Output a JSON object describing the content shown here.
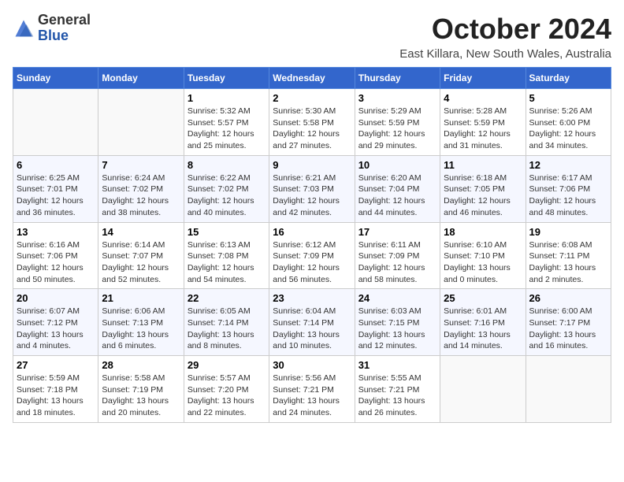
{
  "header": {
    "logo_general": "General",
    "logo_blue": "Blue",
    "month": "October 2024",
    "location": "East Killara, New South Wales, Australia"
  },
  "weekdays": [
    "Sunday",
    "Monday",
    "Tuesday",
    "Wednesday",
    "Thursday",
    "Friday",
    "Saturday"
  ],
  "weeks": [
    [
      {
        "day": "",
        "sunrise": "",
        "sunset": "",
        "daylight": ""
      },
      {
        "day": "",
        "sunrise": "",
        "sunset": "",
        "daylight": ""
      },
      {
        "day": "1",
        "sunrise": "Sunrise: 5:32 AM",
        "sunset": "Sunset: 5:57 PM",
        "daylight": "Daylight: 12 hours and 25 minutes."
      },
      {
        "day": "2",
        "sunrise": "Sunrise: 5:30 AM",
        "sunset": "Sunset: 5:58 PM",
        "daylight": "Daylight: 12 hours and 27 minutes."
      },
      {
        "day": "3",
        "sunrise": "Sunrise: 5:29 AM",
        "sunset": "Sunset: 5:59 PM",
        "daylight": "Daylight: 12 hours and 29 minutes."
      },
      {
        "day": "4",
        "sunrise": "Sunrise: 5:28 AM",
        "sunset": "Sunset: 5:59 PM",
        "daylight": "Daylight: 12 hours and 31 minutes."
      },
      {
        "day": "5",
        "sunrise": "Sunrise: 5:26 AM",
        "sunset": "Sunset: 6:00 PM",
        "daylight": "Daylight: 12 hours and 34 minutes."
      }
    ],
    [
      {
        "day": "6",
        "sunrise": "Sunrise: 6:25 AM",
        "sunset": "Sunset: 7:01 PM",
        "daylight": "Daylight: 12 hours and 36 minutes."
      },
      {
        "day": "7",
        "sunrise": "Sunrise: 6:24 AM",
        "sunset": "Sunset: 7:02 PM",
        "daylight": "Daylight: 12 hours and 38 minutes."
      },
      {
        "day": "8",
        "sunrise": "Sunrise: 6:22 AM",
        "sunset": "Sunset: 7:02 PM",
        "daylight": "Daylight: 12 hours and 40 minutes."
      },
      {
        "day": "9",
        "sunrise": "Sunrise: 6:21 AM",
        "sunset": "Sunset: 7:03 PM",
        "daylight": "Daylight: 12 hours and 42 minutes."
      },
      {
        "day": "10",
        "sunrise": "Sunrise: 6:20 AM",
        "sunset": "Sunset: 7:04 PM",
        "daylight": "Daylight: 12 hours and 44 minutes."
      },
      {
        "day": "11",
        "sunrise": "Sunrise: 6:18 AM",
        "sunset": "Sunset: 7:05 PM",
        "daylight": "Daylight: 12 hours and 46 minutes."
      },
      {
        "day": "12",
        "sunrise": "Sunrise: 6:17 AM",
        "sunset": "Sunset: 7:06 PM",
        "daylight": "Daylight: 12 hours and 48 minutes."
      }
    ],
    [
      {
        "day": "13",
        "sunrise": "Sunrise: 6:16 AM",
        "sunset": "Sunset: 7:06 PM",
        "daylight": "Daylight: 12 hours and 50 minutes."
      },
      {
        "day": "14",
        "sunrise": "Sunrise: 6:14 AM",
        "sunset": "Sunset: 7:07 PM",
        "daylight": "Daylight: 12 hours and 52 minutes."
      },
      {
        "day": "15",
        "sunrise": "Sunrise: 6:13 AM",
        "sunset": "Sunset: 7:08 PM",
        "daylight": "Daylight: 12 hours and 54 minutes."
      },
      {
        "day": "16",
        "sunrise": "Sunrise: 6:12 AM",
        "sunset": "Sunset: 7:09 PM",
        "daylight": "Daylight: 12 hours and 56 minutes."
      },
      {
        "day": "17",
        "sunrise": "Sunrise: 6:11 AM",
        "sunset": "Sunset: 7:09 PM",
        "daylight": "Daylight: 12 hours and 58 minutes."
      },
      {
        "day": "18",
        "sunrise": "Sunrise: 6:10 AM",
        "sunset": "Sunset: 7:10 PM",
        "daylight": "Daylight: 13 hours and 0 minutes."
      },
      {
        "day": "19",
        "sunrise": "Sunrise: 6:08 AM",
        "sunset": "Sunset: 7:11 PM",
        "daylight": "Daylight: 13 hours and 2 minutes."
      }
    ],
    [
      {
        "day": "20",
        "sunrise": "Sunrise: 6:07 AM",
        "sunset": "Sunset: 7:12 PM",
        "daylight": "Daylight: 13 hours and 4 minutes."
      },
      {
        "day": "21",
        "sunrise": "Sunrise: 6:06 AM",
        "sunset": "Sunset: 7:13 PM",
        "daylight": "Daylight: 13 hours and 6 minutes."
      },
      {
        "day": "22",
        "sunrise": "Sunrise: 6:05 AM",
        "sunset": "Sunset: 7:14 PM",
        "daylight": "Daylight: 13 hours and 8 minutes."
      },
      {
        "day": "23",
        "sunrise": "Sunrise: 6:04 AM",
        "sunset": "Sunset: 7:14 PM",
        "daylight": "Daylight: 13 hours and 10 minutes."
      },
      {
        "day": "24",
        "sunrise": "Sunrise: 6:03 AM",
        "sunset": "Sunset: 7:15 PM",
        "daylight": "Daylight: 13 hours and 12 minutes."
      },
      {
        "day": "25",
        "sunrise": "Sunrise: 6:01 AM",
        "sunset": "Sunset: 7:16 PM",
        "daylight": "Daylight: 13 hours and 14 minutes."
      },
      {
        "day": "26",
        "sunrise": "Sunrise: 6:00 AM",
        "sunset": "Sunset: 7:17 PM",
        "daylight": "Daylight: 13 hours and 16 minutes."
      }
    ],
    [
      {
        "day": "27",
        "sunrise": "Sunrise: 5:59 AM",
        "sunset": "Sunset: 7:18 PM",
        "daylight": "Daylight: 13 hours and 18 minutes."
      },
      {
        "day": "28",
        "sunrise": "Sunrise: 5:58 AM",
        "sunset": "Sunset: 7:19 PM",
        "daylight": "Daylight: 13 hours and 20 minutes."
      },
      {
        "day": "29",
        "sunrise": "Sunrise: 5:57 AM",
        "sunset": "Sunset: 7:20 PM",
        "daylight": "Daylight: 13 hours and 22 minutes."
      },
      {
        "day": "30",
        "sunrise": "Sunrise: 5:56 AM",
        "sunset": "Sunset: 7:21 PM",
        "daylight": "Daylight: 13 hours and 24 minutes."
      },
      {
        "day": "31",
        "sunrise": "Sunrise: 5:55 AM",
        "sunset": "Sunset: 7:21 PM",
        "daylight": "Daylight: 13 hours and 26 minutes."
      },
      {
        "day": "",
        "sunrise": "",
        "sunset": "",
        "daylight": ""
      },
      {
        "day": "",
        "sunrise": "",
        "sunset": "",
        "daylight": ""
      }
    ]
  ]
}
